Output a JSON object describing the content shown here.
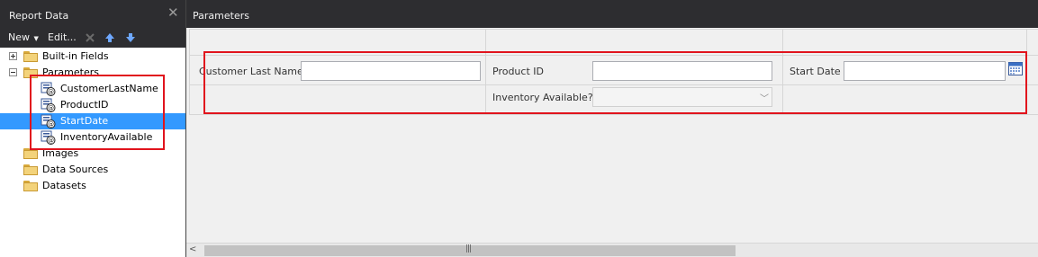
{
  "report_data": {
    "title": "Report Data",
    "toolbar": {
      "new_label": "New",
      "edit_label": "Edit..."
    },
    "tree": [
      {
        "label": "Built-in Fields",
        "type": "folder",
        "expander": "plus",
        "selected": false
      },
      {
        "label": "Parameters",
        "type": "folder",
        "expander": "minus",
        "selected": false
      },
      {
        "label": "CustomerLastName",
        "type": "parameter",
        "selected": false
      },
      {
        "label": "ProductID",
        "type": "parameter",
        "selected": false
      },
      {
        "label": "StartDate",
        "type": "parameter",
        "selected": true
      },
      {
        "label": "InventoryAvailable",
        "type": "parameter",
        "selected": false
      },
      {
        "label": "Images",
        "type": "folder",
        "selected": false
      },
      {
        "label": "Data Sources",
        "type": "folder",
        "selected": false
      },
      {
        "label": "Datasets",
        "type": "folder",
        "selected": false
      }
    ]
  },
  "parameters_pane": {
    "title": "Parameters",
    "fields": {
      "customer_last_name": {
        "label": "Customer Last Name",
        "value": ""
      },
      "product_id": {
        "label": "Product ID",
        "value": ""
      },
      "start_date": {
        "label": "Start Date",
        "value": ""
      },
      "inventory_available": {
        "label": "Inventory Available?",
        "value": ""
      }
    }
  },
  "colors": {
    "dark_chrome": "#2d2d30",
    "selection": "#3399ff",
    "highlight_box": "#e1141d",
    "canvas": "#f0f0f0"
  },
  "icons": {
    "close": "close-icon",
    "move_up": "arrow-up-icon",
    "move_down": "arrow-down-icon",
    "delete": "delete-icon",
    "folder": "folder-icon",
    "parameter": "parameter-icon",
    "calendar": "calendar-icon",
    "dropdown": "chevron-down-icon"
  }
}
